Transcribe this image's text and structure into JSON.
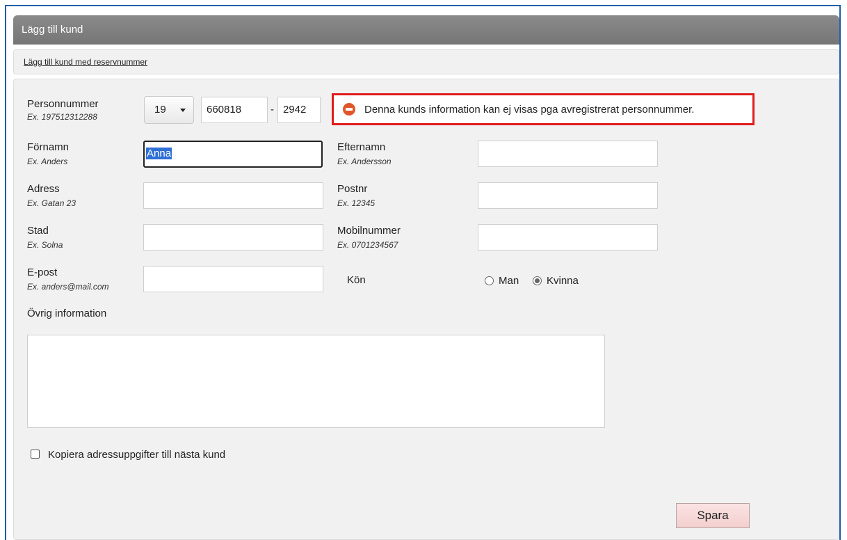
{
  "header": {
    "title": "Lägg till kund"
  },
  "subbar": {
    "link_label": "Lägg till kund med reservnummer"
  },
  "form": {
    "personnummer": {
      "label": "Personnummer",
      "hint": "Ex. 197512312288",
      "century": "19",
      "date_value": "660818",
      "dash": "-",
      "last_value": "2942"
    },
    "alert": {
      "message": "Denna kunds information kan ej visas pga avregistrerat personnummer."
    },
    "fornamn": {
      "label": "Förnamn",
      "hint": "Ex. Anders",
      "value": "Anna"
    },
    "efternamn": {
      "label": "Efternamn",
      "hint": "Ex. Andersson",
      "value": ""
    },
    "adress": {
      "label": "Adress",
      "hint": "Ex. Gatan 23",
      "value": ""
    },
    "postnr": {
      "label": "Postnr",
      "hint": "Ex. 12345",
      "value": ""
    },
    "stad": {
      "label": "Stad",
      "hint": "Ex. Solna",
      "value": ""
    },
    "mobil": {
      "label": "Mobilnummer",
      "hint": "Ex. 0701234567",
      "value": ""
    },
    "epost": {
      "label": "E-post",
      "hint": "Ex. anders@mail.com",
      "value": ""
    },
    "kon": {
      "label": "Kön",
      "option_man": "Man",
      "option_kvinna": "Kvinna",
      "selected": "Kvinna"
    },
    "ovrig": {
      "label": "Övrig information",
      "value": ""
    },
    "kopiera": {
      "label": "Kopiera adressuppgifter till nästa kund",
      "checked": false
    },
    "save_label": "Spara"
  },
  "colors": {
    "alert_border": "#e11b1b",
    "header_bg": "#7f7f7f",
    "save_bg": "#f6d6d6"
  }
}
